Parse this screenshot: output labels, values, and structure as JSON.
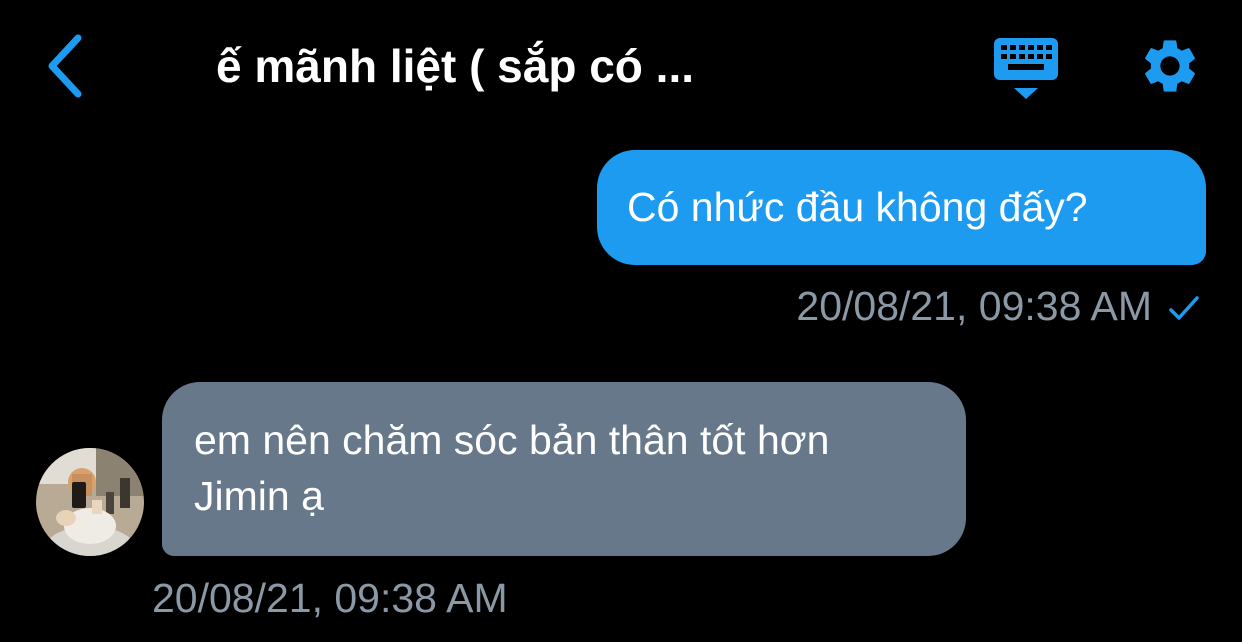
{
  "header": {
    "title": "ế mãnh liệt ( sắp có ...",
    "back_icon": "chevron-left-icon",
    "keyboard_icon": "keyboard-icon",
    "settings_icon": "gear-icon",
    "accent_color": "#1d9bf0"
  },
  "messages": [
    {
      "direction": "outgoing",
      "text": "Có nhức đầu không đấy?",
      "timestamp": "20/08/21, 09:38 AM",
      "status_icon": "checkmark-icon",
      "bubble_color": "#1d9bf0"
    },
    {
      "direction": "incoming",
      "text": "em nên chăm sóc bản thân tốt hơn Jimin ạ",
      "timestamp": "20/08/21, 09:38 AM",
      "bubble_color": "#67788a"
    }
  ],
  "colors": {
    "background": "#000000",
    "timestamp": "#8b98a5"
  }
}
